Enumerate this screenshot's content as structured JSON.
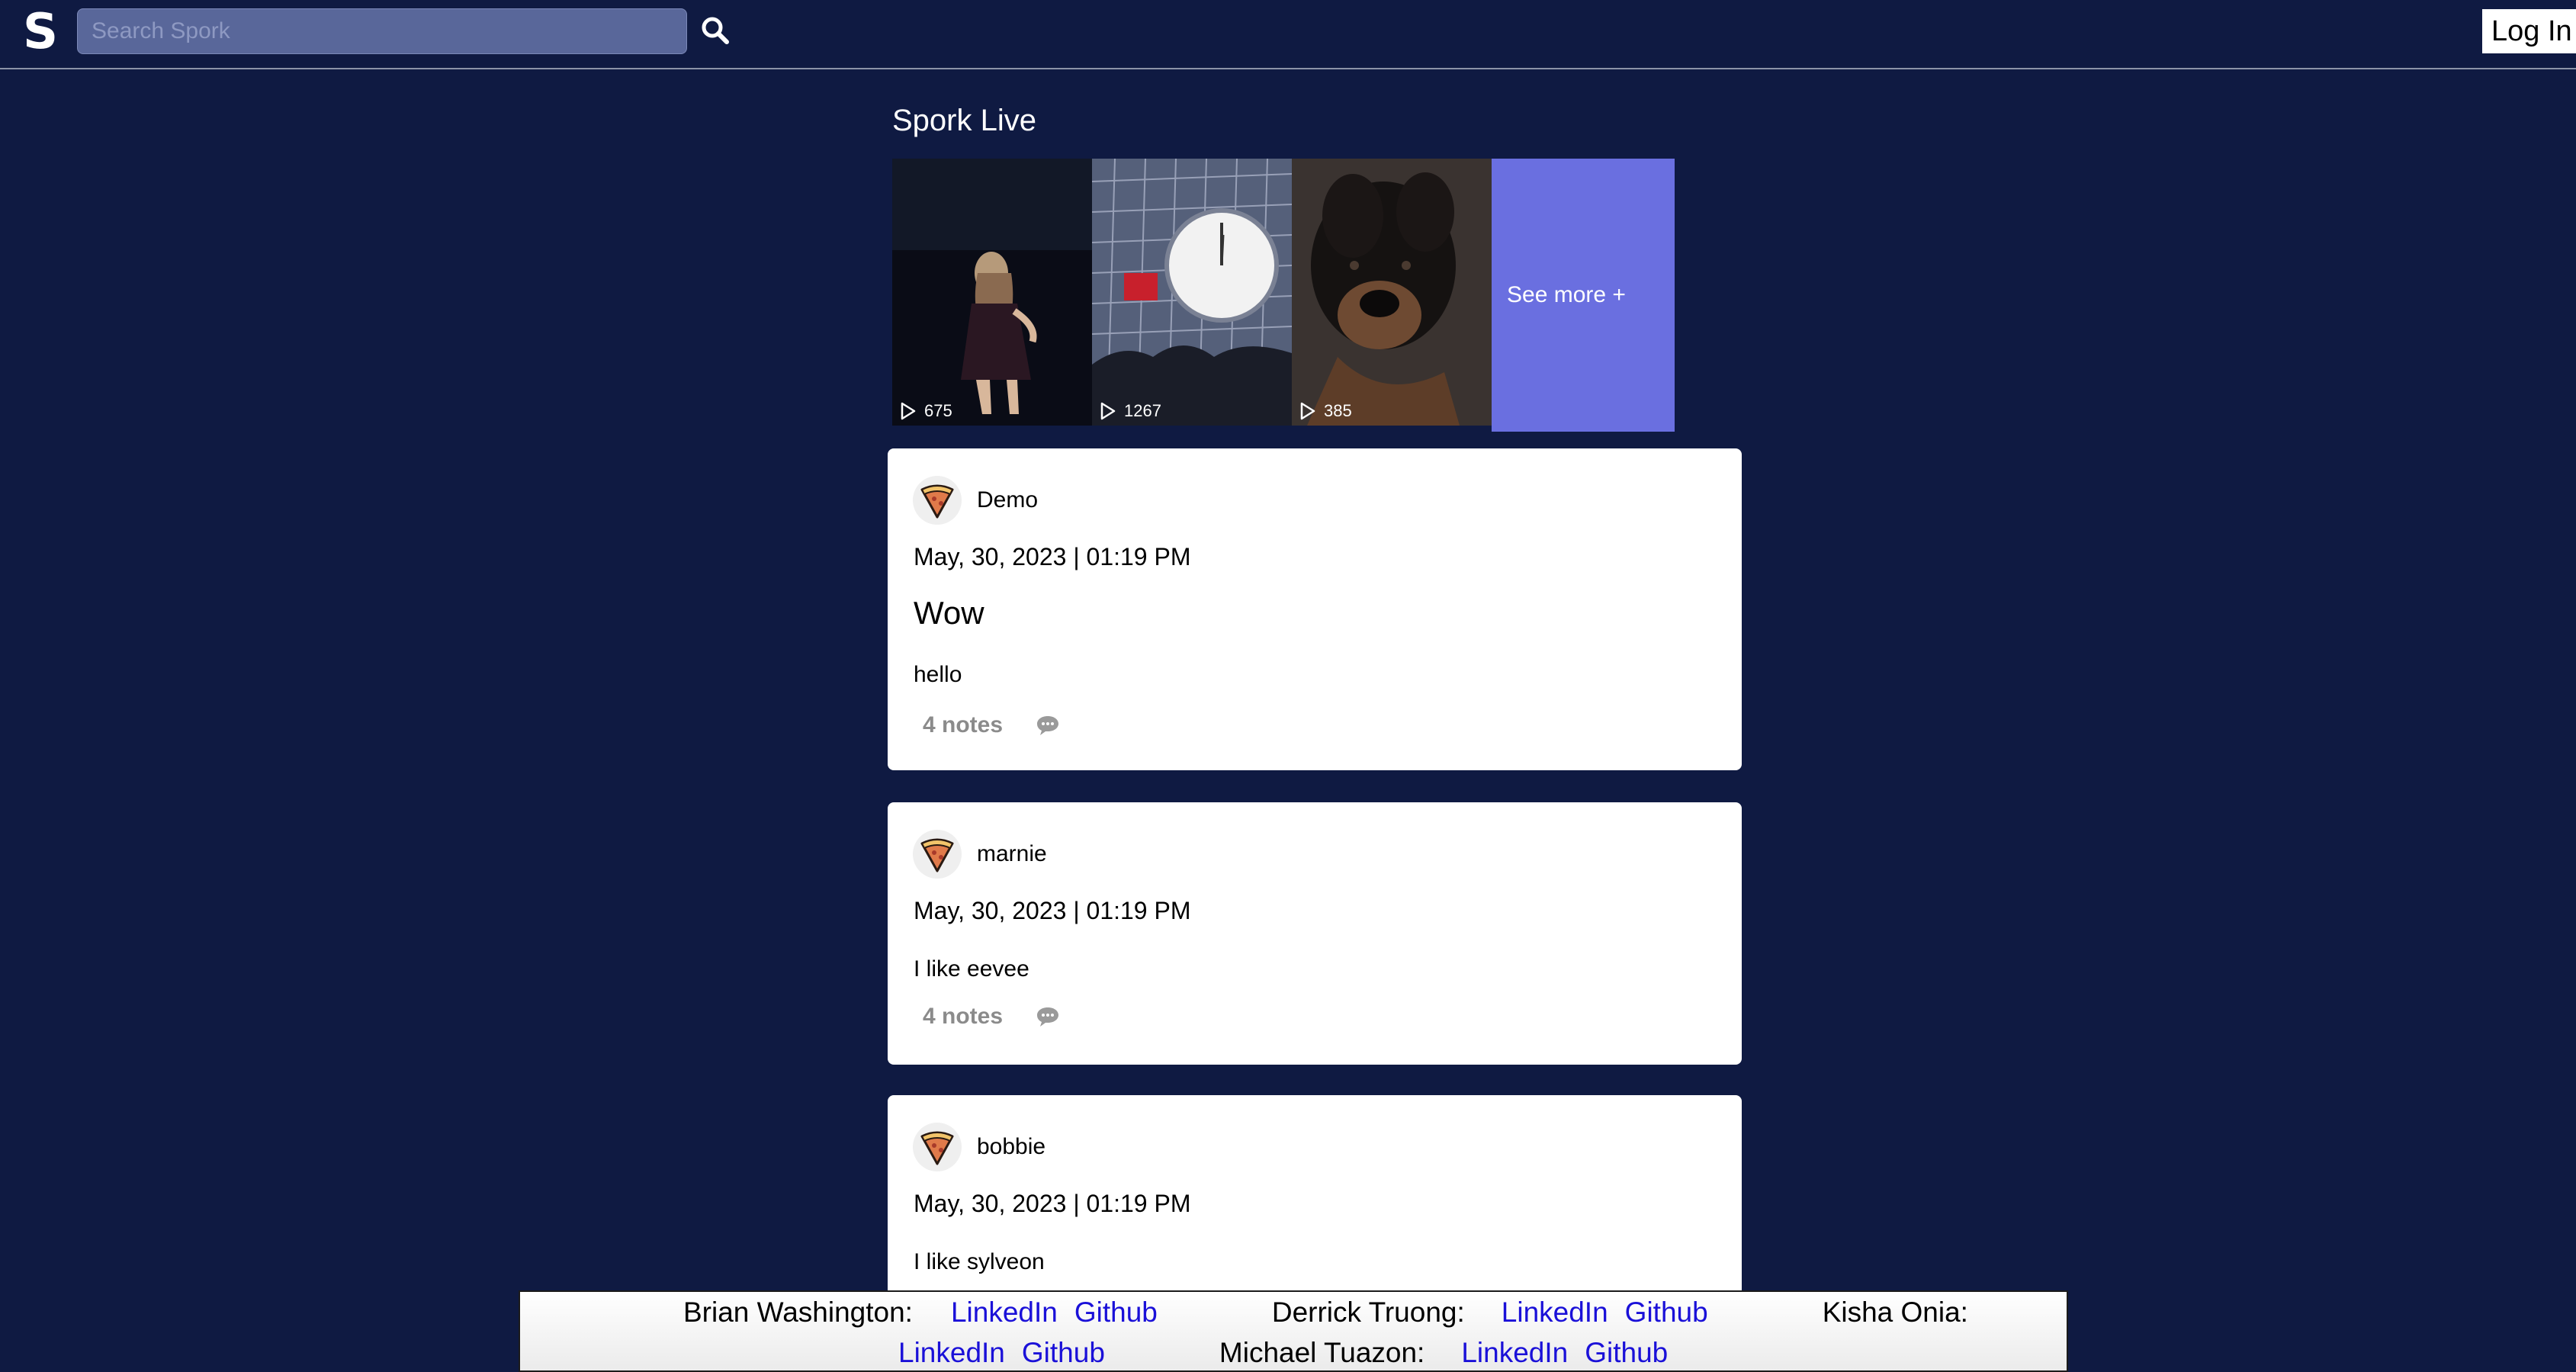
{
  "header": {
    "logo": "S",
    "search_placeholder": "Search Spork",
    "search_value": "",
    "login_label": "Log In"
  },
  "live": {
    "title": "Spork Live",
    "videos": [
      {
        "count": "675",
        "subject": "performer on stage"
      },
      {
        "count": "1267",
        "subject": "concert screen with clock"
      },
      {
        "count": "385",
        "subject": "dog close-up"
      }
    ],
    "see_more": "See more +"
  },
  "posts": [
    {
      "author": "Demo",
      "date": "May, 30, 2023 | 01:19 PM",
      "title": "Wow",
      "body": "hello",
      "notes": "4 notes"
    },
    {
      "author": "marnie",
      "date": "May, 30, 2023 | 01:19 PM",
      "body": "I like eevee",
      "notes": "4 notes"
    },
    {
      "author": "bobbie",
      "date": "May, 30, 2023 | 01:19 PM",
      "body": "I like sylveon"
    }
  ],
  "footer": {
    "people": [
      {
        "name": "Brian Washington:",
        "linkedin": "LinkedIn",
        "github": "Github"
      },
      {
        "name": "Derrick Truong:",
        "linkedin": "LinkedIn",
        "github": "Github"
      },
      {
        "name": "Kisha Onia:",
        "linkedin": "LinkedIn",
        "github": "Github"
      },
      {
        "name": "Michael Tuazon:",
        "linkedin": "LinkedIn",
        "github": "Github"
      }
    ]
  },
  "colors": {
    "background": "#0f1a42",
    "search_bg": "#59679a",
    "see_more_bg": "#6a6fe0",
    "card_bg": "#ffffff",
    "link": "#1a10d8",
    "muted": "#8b8b8b"
  },
  "icons": {
    "search": "search-icon",
    "play": "play-icon",
    "comment": "comment-icon",
    "avatar": "pizza-slice-icon"
  }
}
